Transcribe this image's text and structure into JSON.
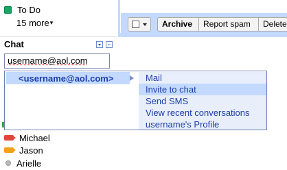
{
  "sidebar": {
    "label_name": "To Do",
    "label_color": "#16a765",
    "more_link": "15 more",
    "more_caret": "▾"
  },
  "chat": {
    "title": "Chat",
    "search_value": "username@aol.com",
    "suggestion": "<username@aol.com>",
    "menu": [
      {
        "label": "Mail"
      },
      {
        "label": "Invite to chat",
        "highlighted": true
      },
      {
        "label": "Send SMS"
      },
      {
        "label": "View recent conversations"
      },
      {
        "label": "username's Profile"
      }
    ],
    "contacts": [
      {
        "name": "Michael",
        "status_icon": "video-camera-icon",
        "status_color": "#e0463a"
      },
      {
        "name": "Jason",
        "status_icon": "video-camera-icon",
        "status_color": "#f0a21a"
      },
      {
        "name": "Arielle",
        "status_icon": "offline-dot-icon",
        "status_color": "#b9b9b9"
      }
    ]
  },
  "toolbar": {
    "archive_label": "Archive",
    "spam_label": "Report spam",
    "delete_label": "Delete"
  },
  "colors": {
    "accent_blue": "#c3d9ff",
    "link_blue": "#1b3fa8"
  }
}
